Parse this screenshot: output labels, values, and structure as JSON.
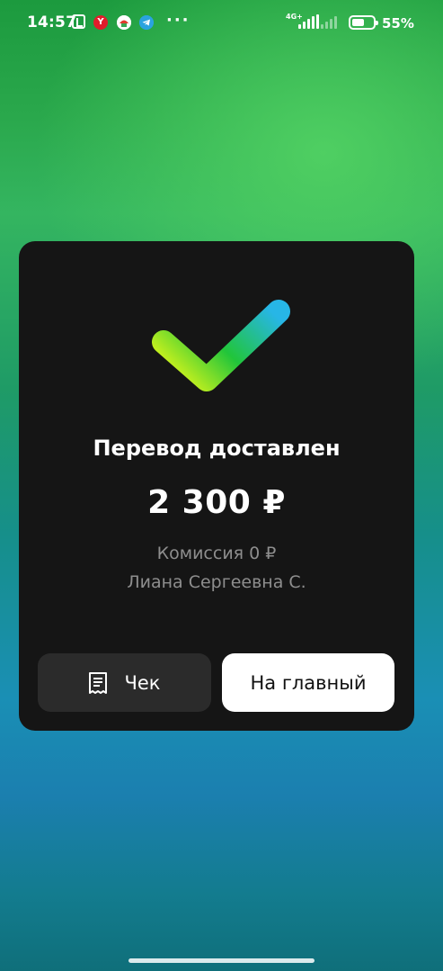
{
  "status_bar": {
    "time": "14:57",
    "app_icons": [
      "nfc-icon",
      "yandex-icon",
      "app-icon",
      "telegram-icon"
    ],
    "yandex_letter": "Y",
    "overflow": "···",
    "network": "4G+",
    "battery_percent": "55%"
  },
  "card": {
    "title": "Перевод доставлен",
    "amount": "2 300 ₽",
    "fee": "Комиссия 0 ₽",
    "recipient": "Лиана Сергеевна С.",
    "receipt_button": "Чек",
    "home_button": "На главный"
  },
  "colors": {
    "card_background": "#151515",
    "check_gradient_start": "#c5f01e",
    "check_gradient_mid": "#21c53a",
    "check_gradient_end": "#27b6e6",
    "secondary_text": "#8e8e8e",
    "receipt_button_bg": "#2b2b2b",
    "home_button_bg": "#ffffff"
  }
}
